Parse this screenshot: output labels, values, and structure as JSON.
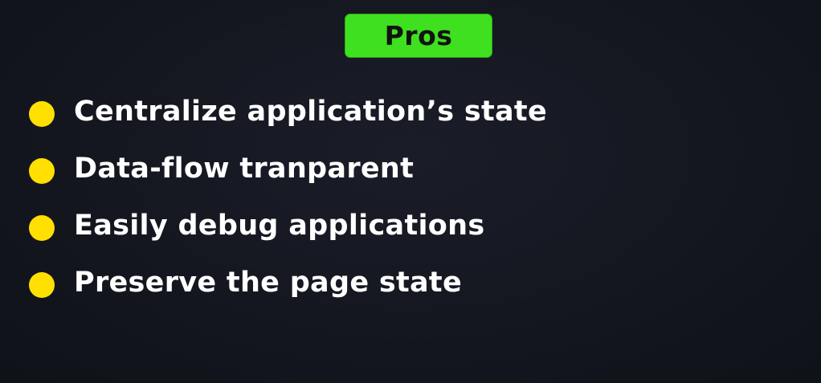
{
  "header": {
    "badge_label": "Pros"
  },
  "colors": {
    "background": "#14161f",
    "badge": "#3ee01f",
    "bullet": "#ffe000",
    "text": "#ffffff"
  },
  "pros": {
    "items": [
      {
        "label": "Centralize application’s state"
      },
      {
        "label": "Data-flow tranparent"
      },
      {
        "label": "Easily debug applications"
      },
      {
        "label": "Preserve the page state"
      }
    ]
  }
}
